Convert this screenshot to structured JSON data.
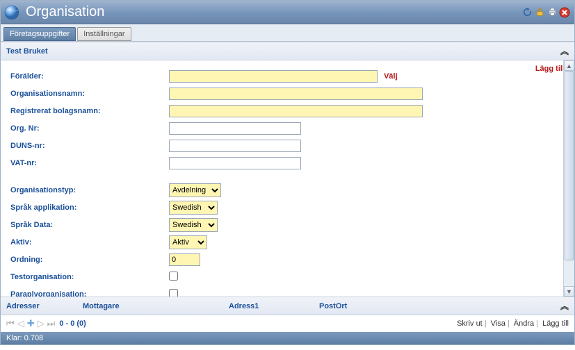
{
  "title": "Organisation",
  "tabs": {
    "t0": "Företagsuppgifter",
    "t1": "Inställningar"
  },
  "section": {
    "name": "Test Bruket"
  },
  "actions": {
    "add": "Lägg till"
  },
  "form": {
    "parent_label": "Förälder:",
    "parent_link": "Välj",
    "orgname_label": "Organisationsnamn:",
    "regname_label": "Registrerat bolagsnamn:",
    "orgno_label": "Org. Nr:",
    "duns_label": "DUNS-nr:",
    "vat_label": "VAT-nr:",
    "orgtype_label": "Organisationstyp:",
    "orgtype_value": "Avdelning",
    "langapp_label": "Språk applikation:",
    "langapp_value": "Swedish",
    "langdata_label": "Språk Data:",
    "langdata_value": "Swedish",
    "active_label": "Aktiv:",
    "active_value": "Aktiv",
    "order_label": "Ordning:",
    "order_value": "0",
    "testorg_label": "Testorganisation:",
    "umbrella_label": "Paraplyorganisation:"
  },
  "address": {
    "col0": "Adresser",
    "col1": "Mottagare",
    "col2": "Adress1",
    "col3": "PostOrt"
  },
  "pager": {
    "text": "0 - 0 (0)",
    "print": "Skriv ut",
    "show": "Visa",
    "edit": "Ändra",
    "add": "Lägg till"
  },
  "status": "Klar: 0.708"
}
